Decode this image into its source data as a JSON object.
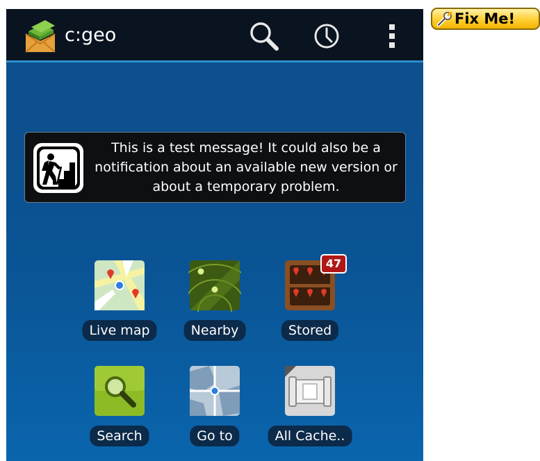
{
  "actionbar": {
    "title": "c:geo",
    "icons": [
      "app-logo-icon",
      "search-icon",
      "history-icon",
      "overflow-menu-icon"
    ]
  },
  "message": {
    "text": "This is a test message! It could also be a notification about an available new version or about a temporary problem.",
    "icon": "hiker-icon"
  },
  "tiles": [
    {
      "label": "Live map",
      "icon": "live-map-icon"
    },
    {
      "label": "Nearby",
      "icon": "nearby-radar-icon"
    },
    {
      "label": "Stored",
      "icon": "stored-caches-icon",
      "badge": "47"
    },
    {
      "label": "Search",
      "icon": "search-magnifier-icon"
    },
    {
      "label": "Go to",
      "icon": "go-to-icon"
    },
    {
      "label": "All Cache..",
      "icon": "all-caches-icon"
    }
  ],
  "fixme": {
    "label": "Fix Me!",
    "icon": "wrench-icon"
  },
  "colors": {
    "actionbar_bg": "#0a1320",
    "accent_line": "#2c8fd0",
    "screen_bg": "#0c508f",
    "badge": "#b01717"
  }
}
